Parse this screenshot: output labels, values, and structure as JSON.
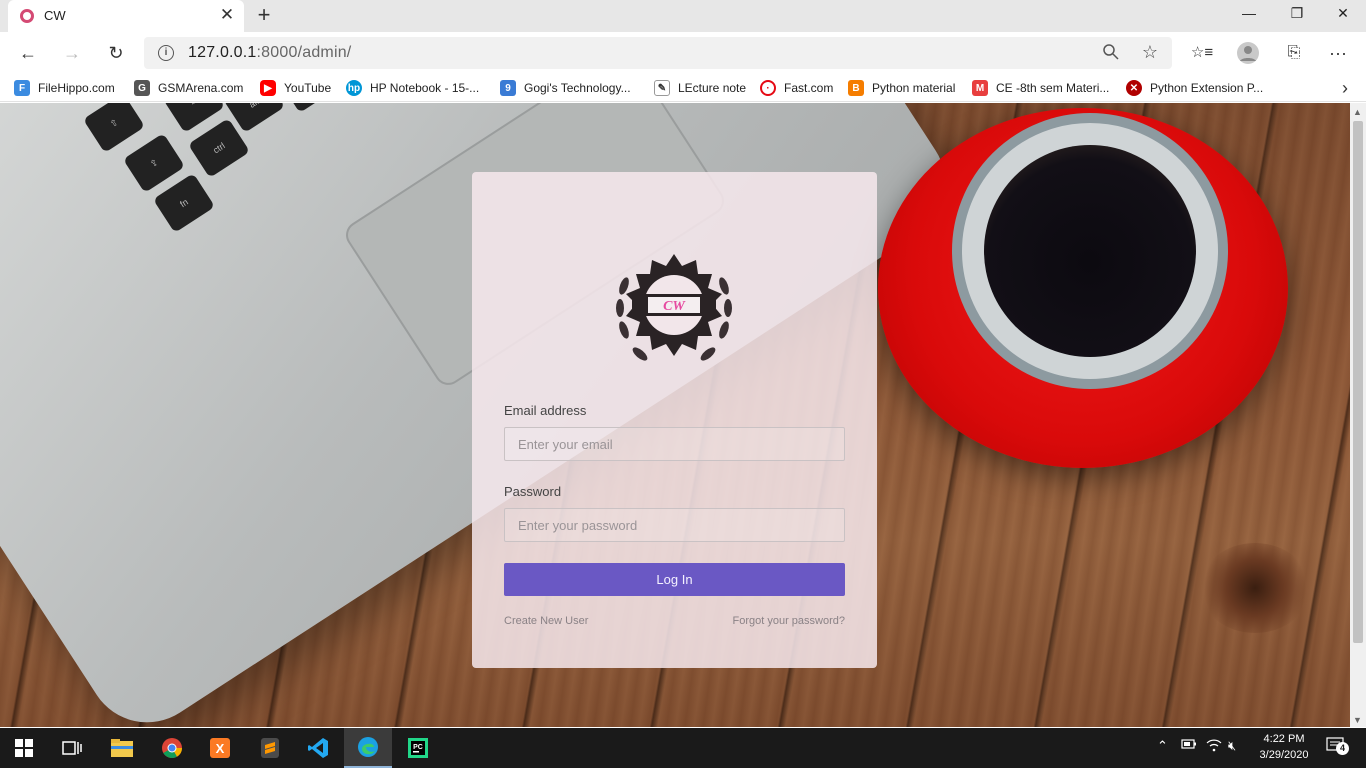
{
  "tab": {
    "title": "CW",
    "close": "✕",
    "new": "+"
  },
  "window": {
    "minimize": "—",
    "restore": "❐",
    "close": "✕"
  },
  "nav": {
    "back": "←",
    "forward": "→",
    "reload": "↻",
    "favorites": "☆≡",
    "collections": "⎘",
    "menu": "···"
  },
  "address": {
    "host": "127.0.0.1",
    "port_path": ":8000/admin/"
  },
  "bookmarks": [
    {
      "label": "FileHippo.com",
      "icon": "filehippo-icon",
      "color": "#3b8be0"
    },
    {
      "label": "GSMArena.com",
      "icon": "gsmarena-icon",
      "color": "#555555"
    },
    {
      "label": "YouTube",
      "icon": "youtube-icon",
      "color": "#ff0000"
    },
    {
      "label": "HP Notebook - 15-...",
      "icon": "hp-icon",
      "color": "#0096d6"
    },
    {
      "label": "Gogi's Technology...",
      "icon": "gogi-icon",
      "color": "#3a7bd5"
    },
    {
      "label": "LEcture note",
      "icon": "lecture-note-icon",
      "color": "#444444"
    },
    {
      "label": "Fast.com",
      "icon": "fast-icon",
      "color": "#e50914"
    },
    {
      "label": "Python material",
      "icon": "blogger-icon",
      "color": "#f57d00"
    },
    {
      "label": "CE -8th sem Materi...",
      "icon": "ce-icon",
      "color": "#e83e3e"
    },
    {
      "label": "Python Extension P...",
      "icon": "python-extension-icon",
      "color": "#b00000"
    }
  ],
  "login": {
    "logo_text": "CW",
    "email_label": "Email address",
    "email_placeholder": "Enter your email",
    "password_label": "Password",
    "password_placeholder": "Enter your password",
    "button": "Log In",
    "create_user": "Create New User",
    "forgot": "Forgot your password?"
  },
  "taskbar": {
    "time": "4:22 PM",
    "date": "3/29/2020",
    "notifications": "4",
    "apps": [
      "start-icon",
      "task-view-icon",
      "file-explorer-icon",
      "chrome-icon",
      "xampp-icon",
      "sublime-icon",
      "vscode-icon",
      "edge-icon",
      "pycharm-icon"
    ]
  },
  "colors": {
    "accent": "#6a58c4",
    "logo_pink": "#e64aa0",
    "saucer_red": "#e01010"
  }
}
